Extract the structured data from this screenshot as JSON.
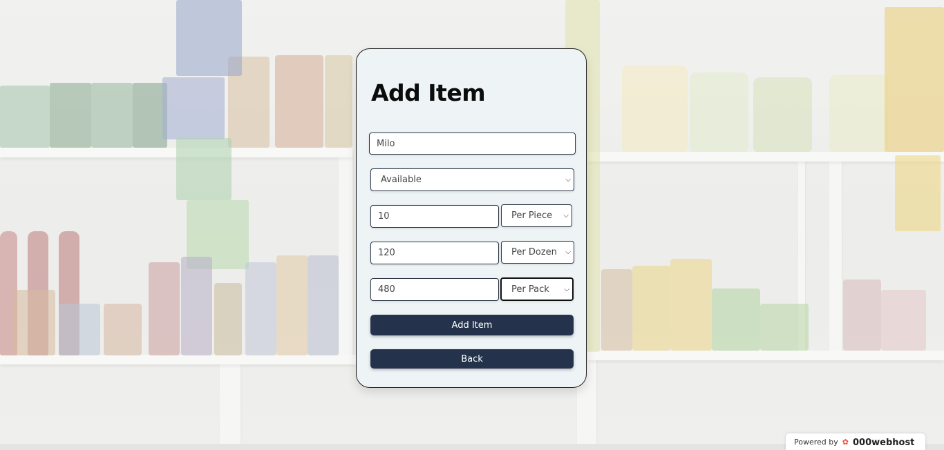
{
  "form": {
    "title": "Add Item",
    "item_name": "Milo",
    "availability": "Available",
    "prices": [
      {
        "amount": "10",
        "unit": "Per Piece"
      },
      {
        "amount": "120",
        "unit": "Per Dozen"
      },
      {
        "amount": "480",
        "unit": "Per Pack"
      }
    ],
    "add_button": "Add Item",
    "back_button": "Back"
  },
  "footer": {
    "powered_by": "Powered by",
    "brand": "000webhost"
  },
  "icons": {
    "select_chevron": "chevron-down-icon",
    "brand_logo": "000webhost-logo-icon"
  },
  "colors": {
    "button": "#24324b",
    "card": "#eef3f6",
    "border": "#1e1e1e"
  }
}
